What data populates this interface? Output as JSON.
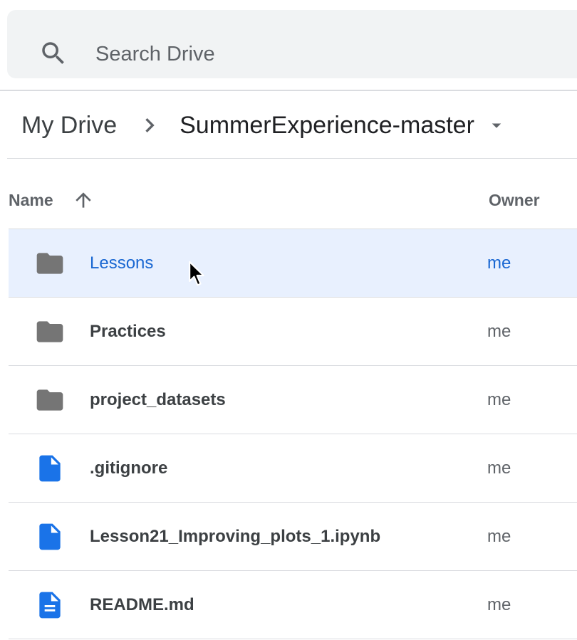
{
  "search": {
    "placeholder": "Search Drive",
    "icon": "search-icon"
  },
  "breadcrumb": {
    "root": "My Drive",
    "current": "SummerExperience-master"
  },
  "columns": {
    "name": "Name",
    "owner": "Owner",
    "sort_direction": "ascending"
  },
  "files": [
    {
      "name": "Lessons",
      "owner": "me",
      "type": "folder",
      "selected": true
    },
    {
      "name": "Practices",
      "owner": "me",
      "type": "folder",
      "selected": false
    },
    {
      "name": "project_datasets",
      "owner": "me",
      "type": "folder",
      "selected": false
    },
    {
      "name": ".gitignore",
      "owner": "me",
      "type": "file",
      "selected": false
    },
    {
      "name": "Lesson21_Improving_plots_1.ipynb",
      "owner": "me",
      "type": "file",
      "selected": false
    },
    {
      "name": "README.md",
      "owner": "me",
      "type": "doc",
      "selected": false
    }
  ],
  "colors": {
    "selected_bg": "#e8f0fe",
    "selected_text": "#1967d2",
    "folder_icon": "#757575",
    "file_icon": "#1a73e8"
  }
}
